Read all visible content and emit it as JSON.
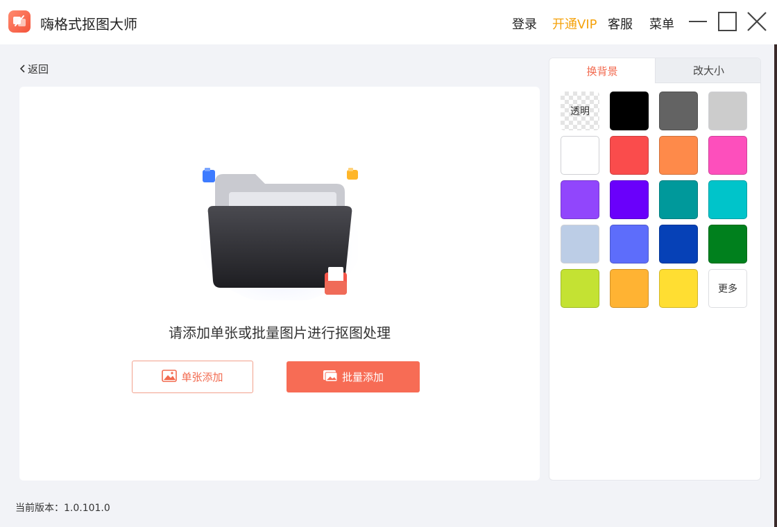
{
  "app": {
    "title": "嗨格式抠图大师"
  },
  "top_nav": {
    "login": "登录",
    "vip": "开通VIP",
    "service": "客服",
    "menu": "菜单"
  },
  "back_label": "返回",
  "upload": {
    "prompt": "请添加单张或批量图片进行抠图处理",
    "single_label": "单张添加",
    "batch_label": "批量添加"
  },
  "tabs": {
    "background": "换背景",
    "resize": "改大小"
  },
  "swatches": [
    {
      "label": "透明",
      "type": "transparent"
    },
    {
      "color": "#000000"
    },
    {
      "color": "#636363"
    },
    {
      "color": "#cccccc"
    },
    {
      "color": "#ffffff"
    },
    {
      "color": "#fa4c4c"
    },
    {
      "color": "#fe8a4a"
    },
    {
      "color": "#fd4fbc"
    },
    {
      "color": "#9146fc"
    },
    {
      "color": "#6a00fb"
    },
    {
      "color": "#00999b"
    },
    {
      "color": "#00c4ca"
    },
    {
      "color": "#bccde6"
    },
    {
      "color": "#5d6dfb"
    },
    {
      "color": "#0641b7"
    },
    {
      "color": "#00801d"
    },
    {
      "color": "#c4e233"
    },
    {
      "color": "#ffb333"
    },
    {
      "color": "#ffde32"
    },
    {
      "label": "更多",
      "type": "more"
    }
  ],
  "footer": {
    "version": "当前版本：1.0.101.0"
  }
}
